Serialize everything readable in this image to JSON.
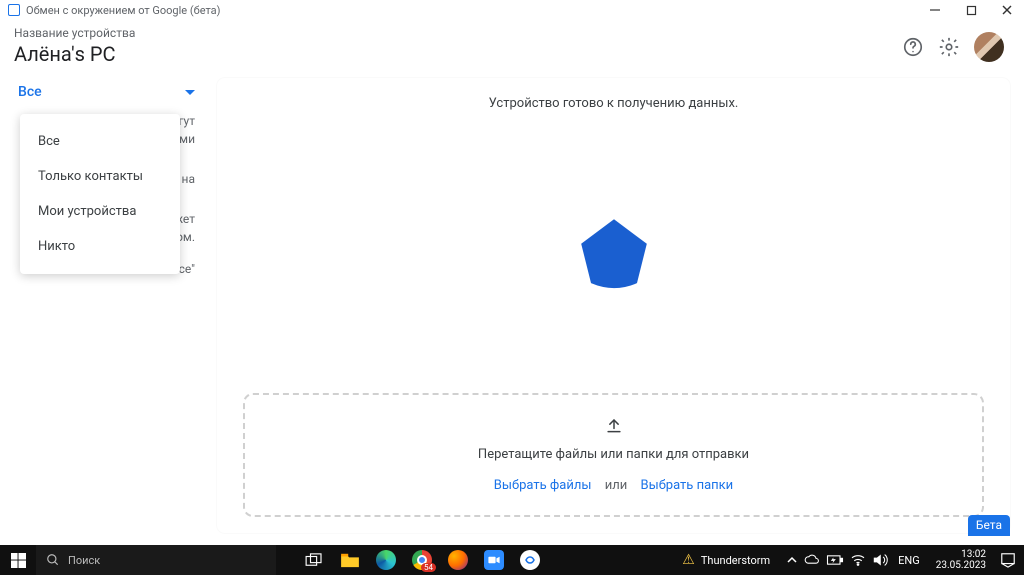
{
  "window": {
    "title": "Обмен с окружением от Google (бета)"
  },
  "header": {
    "device_label": "Название устройства",
    "device_name": "Алёна's PC"
  },
  "sidebar": {
    "selected": "Все",
    "desc_fragments": [
      "и могут",
      "ами",
      "на",
      "ожет",
      "том.",
      "им \"Все\""
    ],
    "options": [
      "Все",
      "Только контакты",
      "Мои устройства",
      "Никто"
    ]
  },
  "main": {
    "ready": "Устройство готово к получению данных.",
    "drop_text": "Перетащите файлы или папки для отправки",
    "select_files": "Выбрать файлы",
    "or": "или",
    "select_folders": "Выбрать папки",
    "beta": "Бета"
  },
  "taskbar": {
    "search_placeholder": "Поиск",
    "weather": "Thunderstorm",
    "lang": "ENG",
    "time": "13:02",
    "date": "23.05.2023",
    "chrome_badge": "54"
  }
}
